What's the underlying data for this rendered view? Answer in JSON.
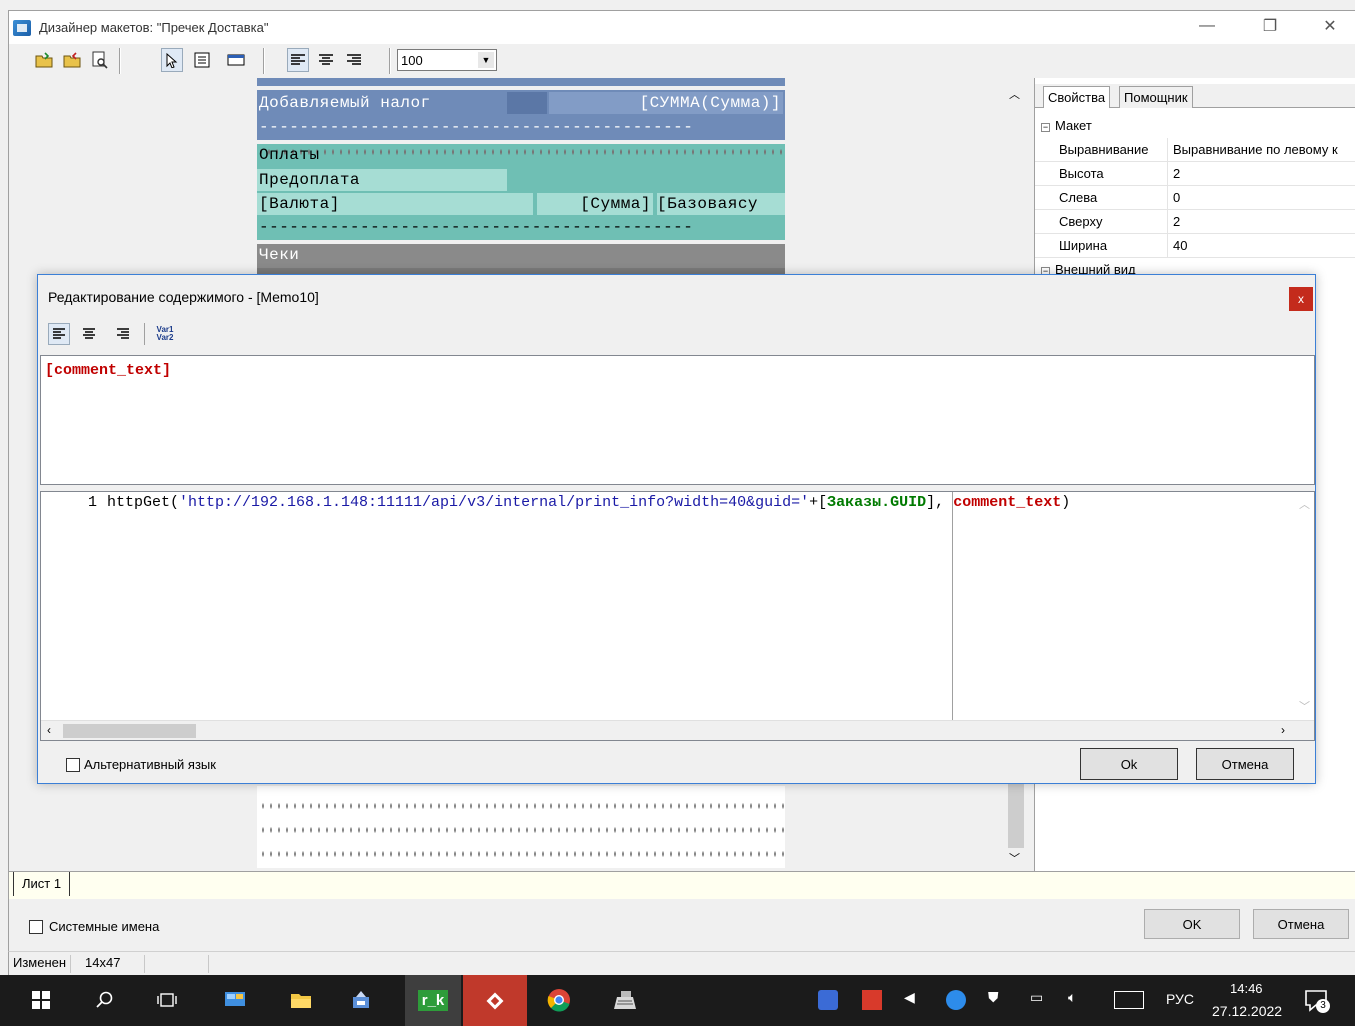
{
  "window": {
    "title": "Дизайнер макетов: \"Пречек Доставка\"",
    "minimize": "—",
    "restore": "❐",
    "close": "✕"
  },
  "toolbar": {
    "zoom_value": "100"
  },
  "report": {
    "row_tax_label": "Добавляемый налог",
    "row_tax_value": "[СУММА(Сумма)]",
    "row_dashes": "-------------------------------------------",
    "row_payments": "Оплаты",
    "row_prepay": "Предоплата",
    "row_currency": "[Валюта]",
    "row_sum": "[Сумма]",
    "row_base": "[Базоваясу",
    "row_checks": "Чеки"
  },
  "properties": {
    "tab_properties": "Свойства",
    "tab_helper": "Помощник",
    "category_layout": "Макет",
    "rows": [
      {
        "key": "Выравнивание",
        "value": "Выравнивание по левому к"
      },
      {
        "key": "Высота",
        "value": "2"
      },
      {
        "key": "Слева",
        "value": "0"
      },
      {
        "key": "Сверху",
        "value": "2"
      },
      {
        "key": "Ширина",
        "value": "40"
      }
    ],
    "category_appearance": "Внешний вид"
  },
  "dialog": {
    "title": "Редактирование содержимого - [Memo10]",
    "close": "x",
    "vars_line1": "Var1",
    "vars_line2": "Var2",
    "memo_text": "[comment_text]",
    "line_number": "1",
    "code": {
      "part1": "httpGet(",
      "part2": "'http://192.168.1.148:11111/api/v3/internal/print_info?width=40&guid='",
      "part3": "+[",
      "part4": "Заказы.GUID",
      "part5": "], ",
      "part6": "comment_text",
      "part7": ")"
    },
    "alt_language": "Альтернативный язык",
    "ok": "Ok",
    "cancel": "Отмена"
  },
  "sheet_tab": "Лист 1",
  "bottom": {
    "system_names": "Системные имена",
    "ok": "OK",
    "cancel": "Отмена"
  },
  "status": {
    "state": "Изменен",
    "size": "14x47"
  },
  "taskbar": {
    "lang": "РУС",
    "time": "14:46",
    "date": "27.12.2022",
    "notifications": "3",
    "app_label": "r_k"
  },
  "colors": {
    "band_blue": "#6f8bb8",
    "band_teal": "#6fbfb4",
    "band_gray": "#8a8a8a",
    "code_string": "#1a1aa6",
    "code_field": "#007a00",
    "code_var": "#c00000"
  }
}
